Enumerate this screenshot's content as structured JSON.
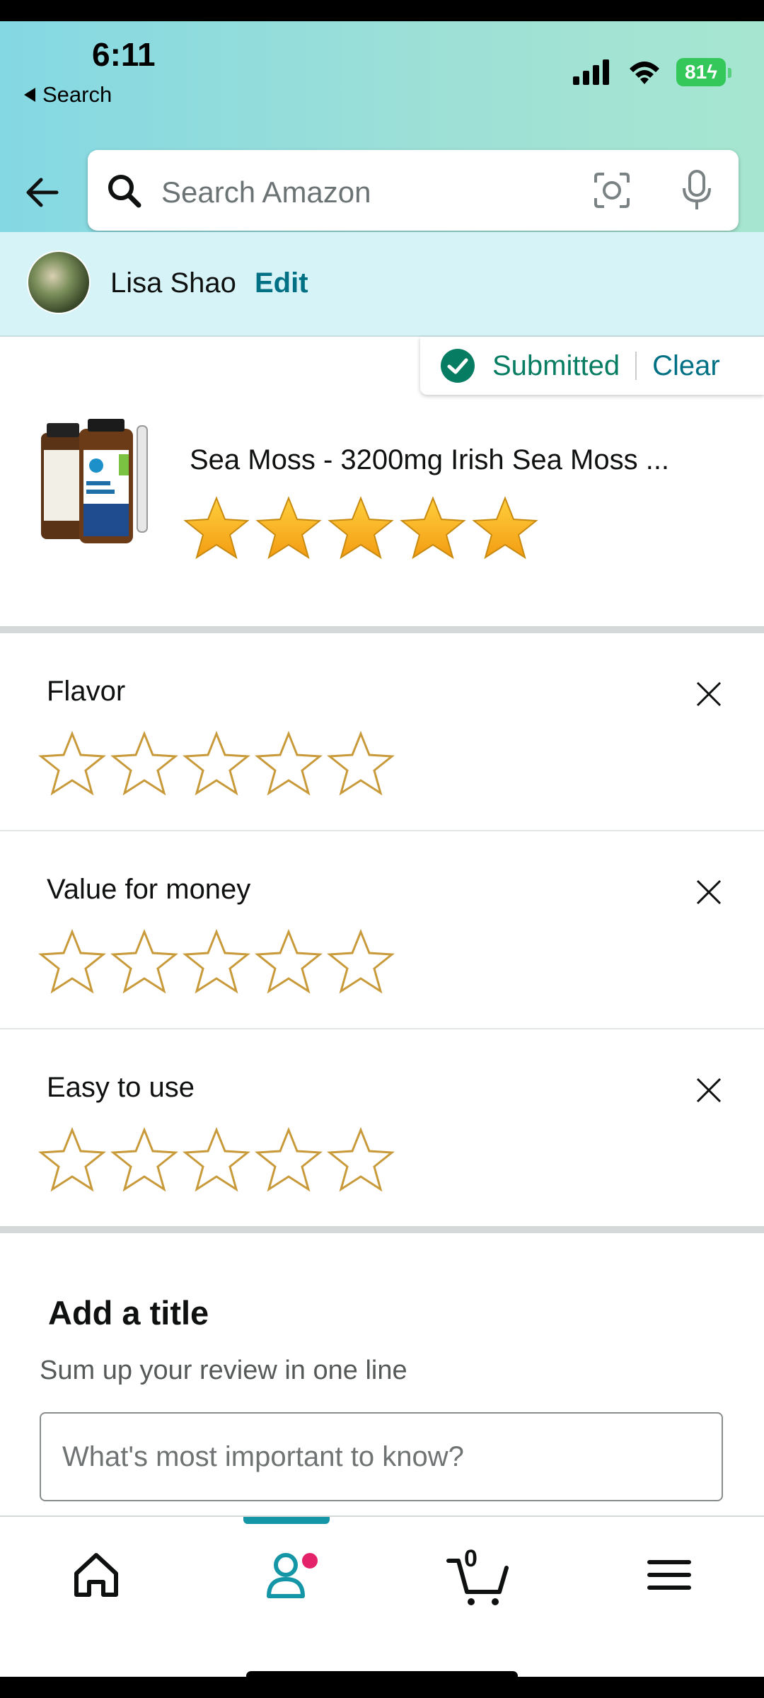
{
  "status_bar": {
    "time": "6:11",
    "back_label": "Search",
    "battery": "81"
  },
  "search": {
    "placeholder": "Search Amazon"
  },
  "profile": {
    "name": "Lisa Shao",
    "edit_label": "Edit"
  },
  "submission": {
    "status": "Submitted",
    "clear_label": "Clear"
  },
  "product": {
    "title": "Sea Moss - 3200mg Irish Sea Moss ...",
    "rating": 5,
    "rating_max": 5
  },
  "attributes": [
    {
      "label": "Flavor",
      "rating": 0
    },
    {
      "label": "Value for money",
      "rating": 0
    },
    {
      "label": "Easy to use",
      "rating": 0
    }
  ],
  "review_title": {
    "heading": "Add a title",
    "subheading": "Sum up your review in one line",
    "placeholder": "What's most important to know?"
  },
  "nav": {
    "cart_count": "0",
    "active_tab": "account"
  },
  "colors": {
    "accent": "#007185",
    "star_fill": "#ffa41c",
    "star_outline": "#c89a3a",
    "success": "#067d62"
  }
}
